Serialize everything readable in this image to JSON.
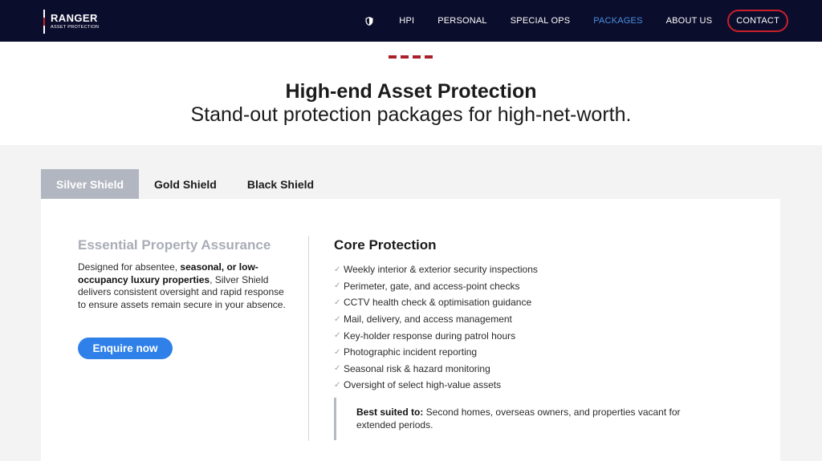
{
  "brand": {
    "name": "RANGER",
    "tagline": "ASSET PROTECTION"
  },
  "nav": {
    "items": [
      {
        "label": "HPI",
        "active": false
      },
      {
        "label": "PERSONAL",
        "active": false
      },
      {
        "label": "SPECIAL OPS",
        "active": false
      },
      {
        "label": "PACKAGES",
        "active": true
      },
      {
        "label": "ABOUT US",
        "active": false
      }
    ],
    "contact_label": "CONTACT"
  },
  "hero": {
    "title": "High-end Asset Protection",
    "subtitle": "Stand-out protection packages for high-net-worth."
  },
  "tabs": [
    {
      "label": "Silver Shield",
      "active": true
    },
    {
      "label": "Gold Shield",
      "active": false
    },
    {
      "label": "Black Shield",
      "active": false
    }
  ],
  "package": {
    "heading": "Essential Property Assurance",
    "desc_part1": "Designed for absentee, ",
    "desc_bold": "seasonal, or low-occupancy luxury properties",
    "desc_part2": ", Silver Shield delivers consistent oversight and rapid response to ensure assets remain secure in your absence.",
    "cta_label": "Enquire now",
    "features_heading": "Core Protection",
    "features": [
      "Weekly interior & exterior security inspections",
      "Perimeter, gate, and access-point checks",
      "CCTV health check & optimisation guidance",
      "Mail, delivery, and access management",
      "Key-holder response during patrol hours",
      "Photographic incident reporting",
      "Seasonal risk & hazard monitoring",
      "Oversight of select high-value assets"
    ],
    "suited_label": "Best suited to:",
    "suited_text": " Second homes, overseas owners, and properties vacant for extended periods."
  },
  "colors": {
    "nav_bg": "#0b0d2c",
    "accent_red": "#c8202b",
    "active_link": "#4a90e2",
    "cta_blue": "#2f80e8",
    "tab_active": "#b1b6c0"
  },
  "icons": {
    "nav_icon": "shield-icon",
    "feature_icon": "check-icon"
  }
}
